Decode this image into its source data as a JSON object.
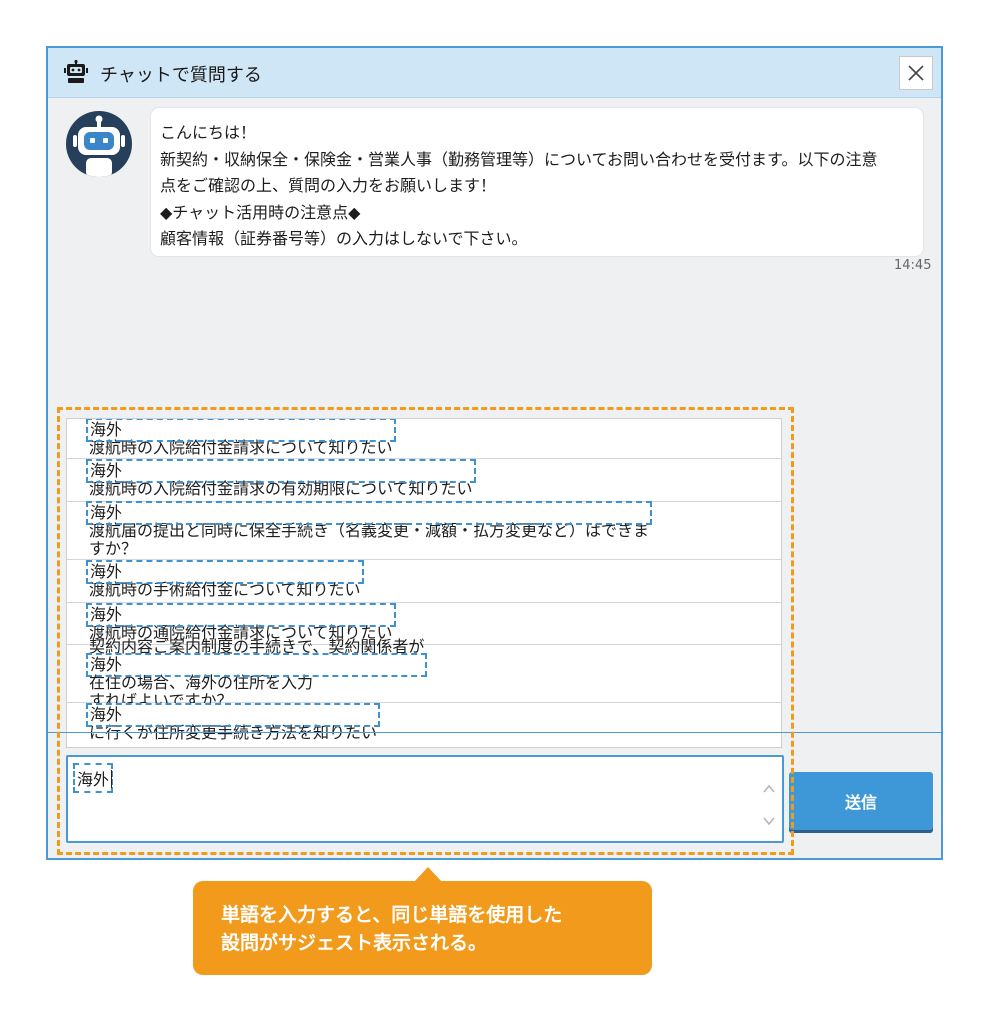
{
  "window": {
    "title": "チャットで質問する"
  },
  "icons": {
    "title_icon": "robot-icon",
    "close_icon": "close-icon",
    "avatar": "robot-avatar-icon",
    "scroll_up": "chevron-up-icon",
    "scroll_down": "chevron-down-icon"
  },
  "message": {
    "lines": [
      "こんにちは！",
      "新契約・収納保全・保険金・営業人事（勤務管理等）についてお問い合わせを受付ます。以下の注意",
      "点をご確認の上、質問の入力をお願いします！",
      "◆チャット活用時の注意点◆",
      "顧客情報（証券番号等）の入力はしないで下さい。"
    ],
    "time": "14:45"
  },
  "suggestions": [
    {
      "pre": "",
      "kw": "海外",
      "post": "渡航時の入院給付金請求について知りたい"
    },
    {
      "pre": "",
      "kw": "海外",
      "post": "渡航時の入院給付金請求の有効期限について知りたい"
    },
    {
      "pre": "",
      "kw": "海外",
      "post": "渡航届の提出と同時に保全手続き（名義変更・減額・払方変更など）はできま",
      "line2": "すか？"
    },
    {
      "pre": "",
      "kw": "海外",
      "post": "渡航時の手術給付金について知りたい"
    },
    {
      "pre": "",
      "kw": "海外",
      "post": "渡航時の通院給付金請求について知りたい"
    },
    {
      "pre": "契約内容ご案内制度の手続きで、契約関係者が",
      "kw": "海外",
      "post": "在住の場合、海外の住所を入力",
      "line2": "すればよいですか？"
    },
    {
      "pre": "",
      "kw": "海外",
      "post": "に行くが住所変更手続き方法を知りたい"
    }
  ],
  "input": {
    "value": "海外"
  },
  "send_label": "送信",
  "callout": {
    "line1": "単語を入力すると、同じ単語を使用した",
    "line2": "設問がサジェスト表示される。"
  },
  "colors": {
    "accent": "#3e97d6",
    "highlight_orange": "#f29a1b",
    "titlebar": "#cfe6f6"
  }
}
